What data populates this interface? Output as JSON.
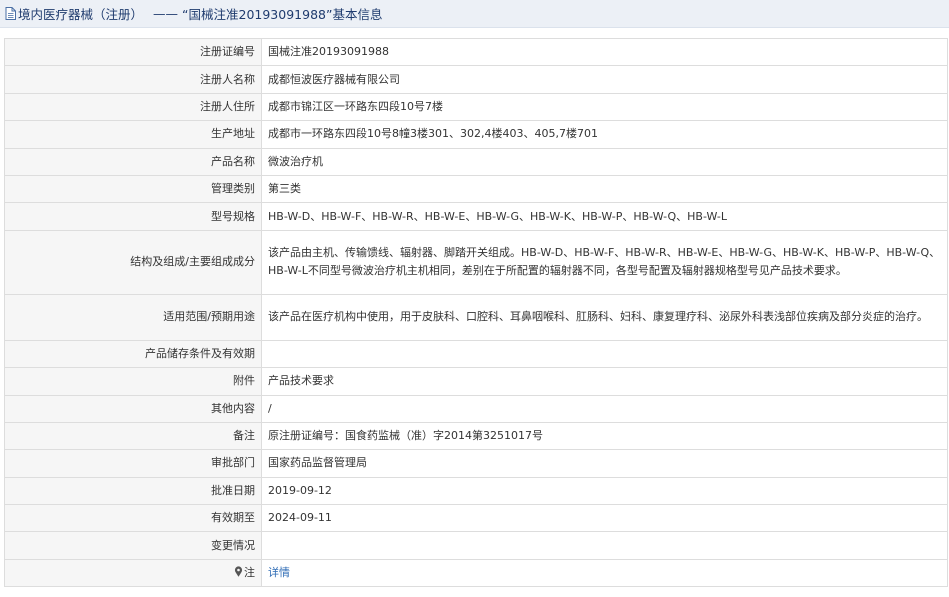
{
  "header": {
    "breadcrumb": "境内医疗器械（注册）",
    "separator": "——",
    "title": "“国械注准20193091988”基本信息"
  },
  "rows": [
    {
      "label": "注册证编号",
      "value": "国械注准20193091988"
    },
    {
      "label": "注册人名称",
      "value": "成都恒波医疗器械有限公司"
    },
    {
      "label": "注册人住所",
      "value": "成都市锦江区一环路东四段10号7楼"
    },
    {
      "label": "生产地址",
      "value": "成都市一环路东四段10号8幢3楼301、302,4楼403、405,7楼701"
    },
    {
      "label": "产品名称",
      "value": "微波治疗机"
    },
    {
      "label": "管理类别",
      "value": "第三类"
    },
    {
      "label": "型号规格",
      "value": "HB-W-D、HB-W-F、HB-W-R、HB-W-E、HB-W-G、HB-W-K、HB-W-P、HB-W-Q、HB-W-L"
    },
    {
      "label": "结构及组成/主要组成成分",
      "value": "该产品由主机、传输馈线、辐射器、脚踏开关组成。HB-W-D、HB-W-F、HB-W-R、HB-W-E、HB-W-G、HB-W-K、HB-W-P、HB-W-Q、HB-W-L不同型号微波治疗机主机相同，差别在于所配置的辐射器不同，各型号配置及辐射器规格型号见产品技术要求。"
    },
    {
      "label": "适用范围/预期用途",
      "value": "该产品在医疗机构中使用，用于皮肤科、口腔科、耳鼻咽喉科、肛肠科、妇科、康复理疗科、泌尿外科表浅部位疾病及部分炎症的治疗。"
    },
    {
      "label": "产品储存条件及有效期",
      "value": ""
    },
    {
      "label": "附件",
      "value": "产品技术要求"
    },
    {
      "label": "其他内容",
      "value": "/"
    },
    {
      "label": "备注",
      "value": "原注册证编号：国食药监械（准）字2014第3251017号"
    },
    {
      "label": "审批部门",
      "value": "国家药品监督管理局"
    },
    {
      "label": "批准日期",
      "value": "2019-09-12"
    },
    {
      "label": "有效期至",
      "value": "2024-09-11"
    },
    {
      "label": "变更情况",
      "value": ""
    }
  ],
  "note": {
    "label": "注",
    "link": "详情"
  },
  "icons": {
    "header": "document-icon",
    "note": "pin-icon"
  },
  "colors": {
    "title": "#1f3b6e",
    "link": "#2d6bb5",
    "label_bg": "#f6f6f6",
    "border": "#dddddd"
  }
}
